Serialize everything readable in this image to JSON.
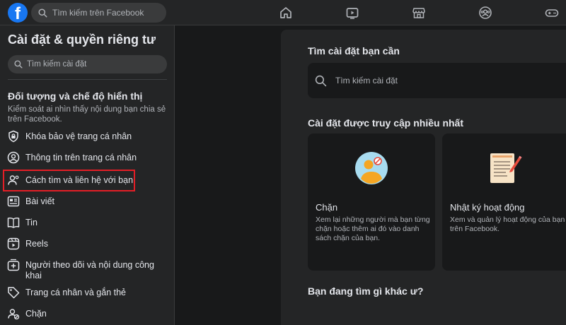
{
  "topbar": {
    "logo": "f",
    "search_placeholder": "Tìm kiếm trên Facebook",
    "nav_icons": [
      "home-icon",
      "video-icon",
      "marketplace-icon",
      "groups-icon",
      "gaming-icon"
    ]
  },
  "sidebar": {
    "title": "Cài đặt & quyền riêng tư",
    "search_placeholder": "Tìm kiếm cài đặt",
    "section": {
      "title": "Đối tượng và chế độ hiển thị",
      "description": "Kiểm soát ai nhìn thấy nội dung bạn chia sẻ trên Facebook."
    },
    "items": [
      {
        "label": "Khóa bảo vệ trang cá nhân",
        "icon": "shield-lock-icon"
      },
      {
        "label": "Thông tin trên trang cá nhân",
        "icon": "profile-icon"
      },
      {
        "label": "Cách tìm và liên hệ với bạn",
        "icon": "find-contact-icon"
      },
      {
        "label": "Bài viết",
        "icon": "posts-icon"
      },
      {
        "label": "Tin",
        "icon": "stories-icon"
      },
      {
        "label": "Reels",
        "icon": "reels-icon"
      },
      {
        "label": "Người theo dõi và nội dung công khai",
        "icon": "followers-icon"
      },
      {
        "label": "Trang cá nhân và gắn thẻ",
        "icon": "tag-icon"
      },
      {
        "label": "Chặn",
        "icon": "block-icon"
      }
    ],
    "highlighted_item": "Cách tìm và liên hệ với bạn"
  },
  "main": {
    "find_heading": "Tìm cài đặt bạn cần",
    "search_placeholder": "Tìm kiếm cài đặt",
    "most_visited_heading": "Cài đặt được truy cập nhiều nhất",
    "cards": [
      {
        "title": "Chặn",
        "description": "Xem lại những người mà bạn từng chặn hoặc thêm ai đó vào danh sách chặn của bạn.",
        "icon": "blocked-user-illustration"
      },
      {
        "title": "Nhật ký hoạt động",
        "description": "Xem và quản lý hoạt động của bạn trên Facebook.",
        "icon": "activity-log-illustration"
      }
    ],
    "looking_for_heading": "Bạn đang tìm gì khác ư?"
  },
  "colors": {
    "background": "#18191a",
    "surface": "#242526",
    "input": "#3a3b3c",
    "brand": "#1877f2",
    "highlight_border": "#e41e26",
    "text_primary": "#e4e6eb",
    "text_secondary": "#b0b3b8"
  }
}
